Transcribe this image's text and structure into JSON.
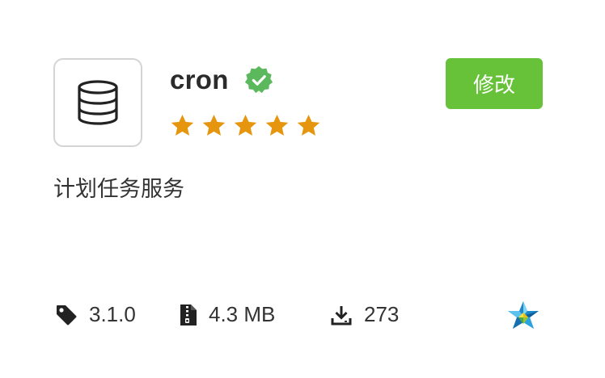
{
  "app": {
    "name": "cron",
    "description": "计划任务服务",
    "icon": "database-icon",
    "verified_icon": "verified-badge-icon",
    "rating_stars": 5,
    "rating_max": 5
  },
  "actions": {
    "edit_label": "修改"
  },
  "meta": {
    "version": "3.1.0",
    "size": "4.3 MB",
    "downloads": "273",
    "version_icon": "tag-icon",
    "size_icon": "zip-file-icon",
    "downloads_icon": "download-icon",
    "source_icon": "star-logo-icon"
  },
  "colors": {
    "accent_green": "#67c23a",
    "star_orange": "#e6960e",
    "verified_green": "#5cb85c"
  }
}
